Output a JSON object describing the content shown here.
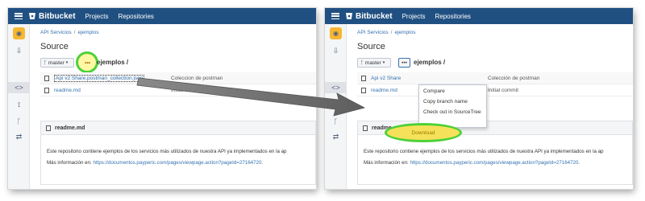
{
  "app": {
    "brand": "Bitbucket",
    "nav": [
      "Projects",
      "Repositories"
    ]
  },
  "breadcrumb": {
    "project": "API Servicios",
    "repo": "ejemplos"
  },
  "page_title": "Source",
  "branch": {
    "label": "master",
    "path": "ejemplos /"
  },
  "more_button": "•••",
  "files": [
    {
      "name": "Api v2 Share.postman_collection.json",
      "name_truncated": "Api v2 Share",
      "commit": "Colección de postman",
      "commit_truncated": "Coleccion de postman"
    },
    {
      "name": "readme.md",
      "name_truncated": "readme.md",
      "commit": "Initial commit"
    }
  ],
  "readme": {
    "title": "readme.md",
    "line1": "Este repositorio contiene ejemplos de los servicios más utilizados de nuestra API ya implementados en la ap",
    "line2_prefix": "Más información en: ",
    "link": "https://documentos.payperic.com/pages/viewpage.action?pageId=27164720",
    "link_suffix": "."
  },
  "dropdown": {
    "items": [
      "Compare",
      "Copy branch name",
      "Check out in SourceTree",
      "Download"
    ]
  },
  "colors": {
    "topbar": "#205081",
    "link": "#3572b0",
    "highlight_ring": "#4cd137",
    "highlight_fill": "#f6e15a",
    "arrow": "#777777"
  }
}
